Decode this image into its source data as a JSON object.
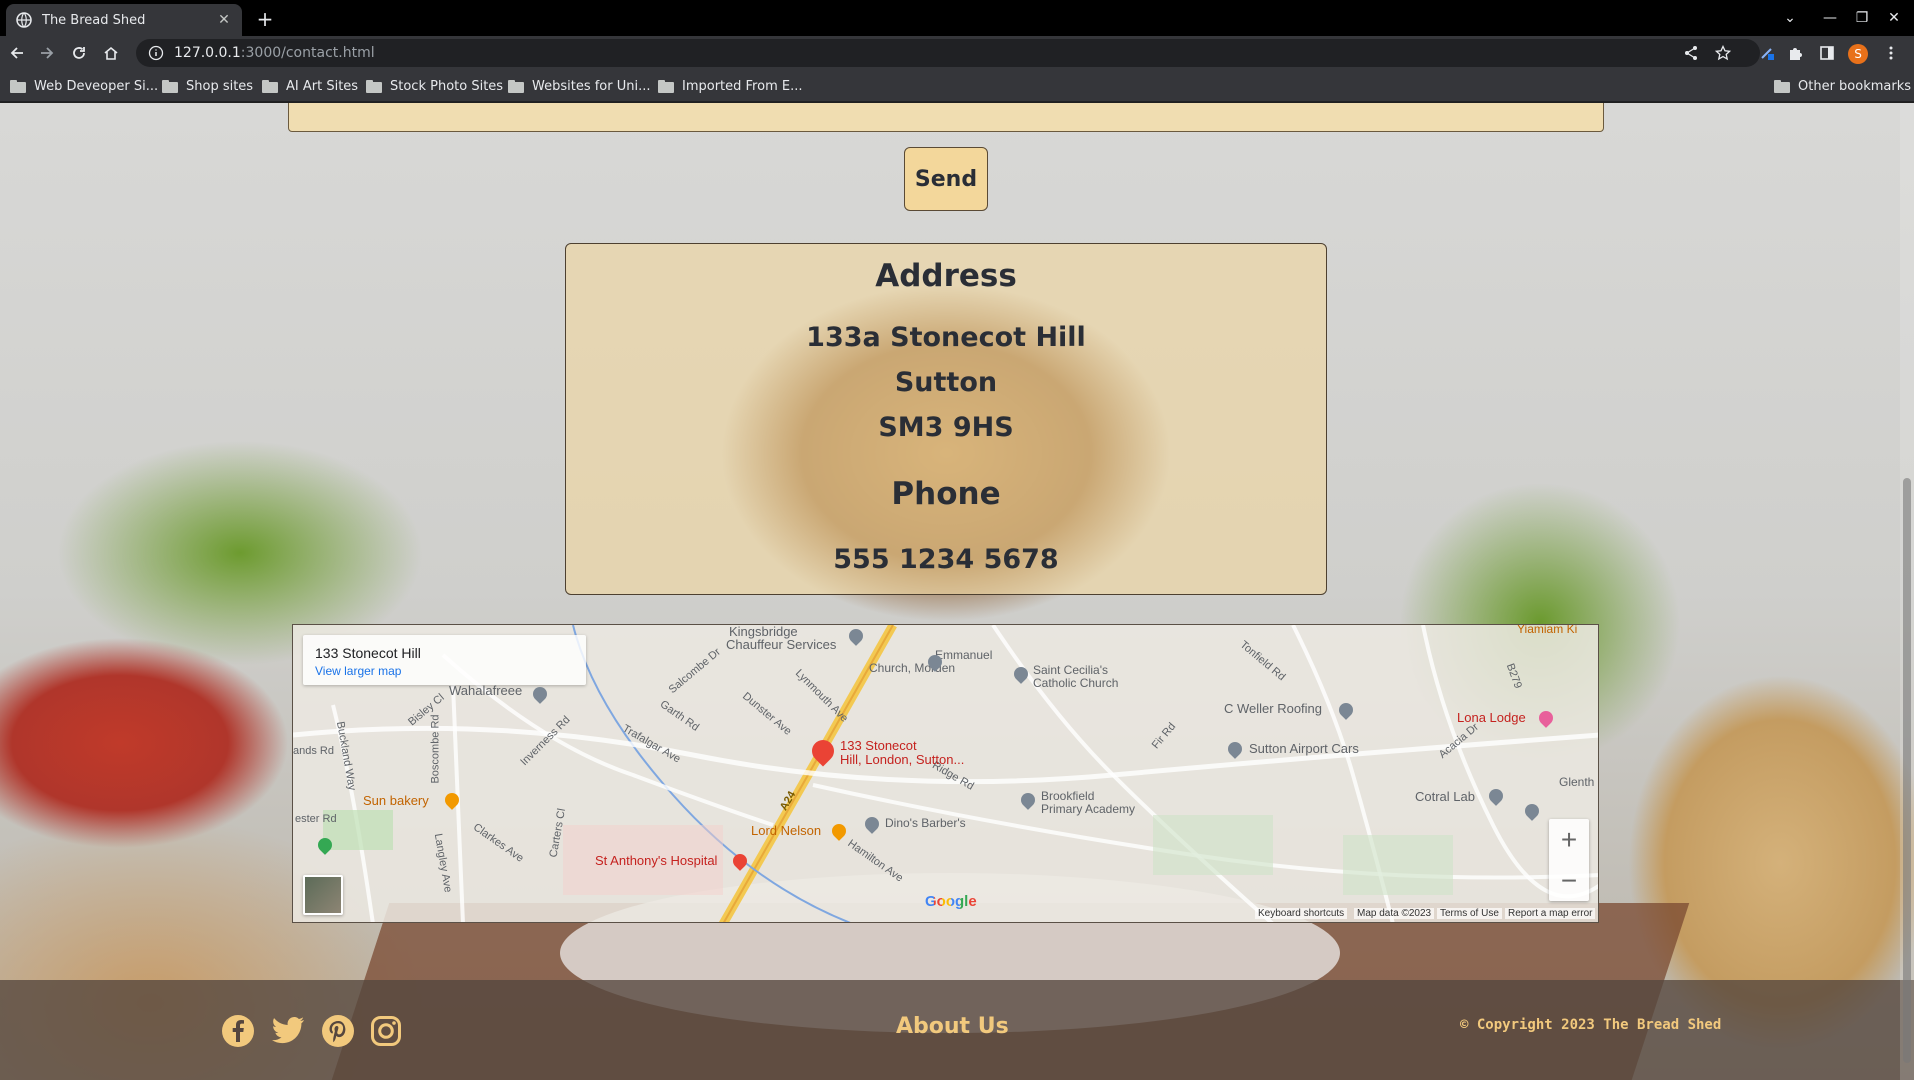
{
  "browser": {
    "tab_title": "The Bread Shed",
    "url_host": "127.0.0.1",
    "url_path": ":3000/contact.html",
    "profile_initial": "S",
    "bookmarks": [
      "Web Deveoper Si...",
      "Shop sites",
      "AI Art Sites",
      "Stock Photo Sites",
      "Websites for Uni...",
      "Imported From E..."
    ],
    "other_bookmarks": "Other bookmarks"
  },
  "page": {
    "send_label": "Send",
    "address_heading": "Address",
    "address_lines": [
      "133a Stonecot Hill",
      "Sutton",
      "SM3 9HS"
    ],
    "phone_heading": "Phone",
    "phone_number": "555 1234 5678"
  },
  "map": {
    "place_title": "133 Stonecot Hill",
    "view_larger": "View larger map",
    "marker_label_1": "133 Stonecot",
    "marker_label_2": "Hill, London, Sutton...",
    "pois": [
      "Kingsbridge",
      "Chauffeur Services",
      "Emmanuel",
      "Church, Morden",
      "Saint Cecilia's",
      "Catholic Church",
      "Wahalafreee",
      "C Weller Roofing",
      "Lona Lodge",
      "Sutton Airport Cars",
      "Sun bakery",
      "Brookfield",
      "Primary Academy",
      "Cotral Lab",
      "Lord Nelson",
      "Dino's Barber's",
      "St Anthony's Hospital",
      "Yiamiam Ki",
      "Glenth"
    ],
    "roads": [
      "Salcombe Dr",
      "Lynmouth Ave",
      "Dunster Ave",
      "Garth Rd",
      "Trafalgar Ave",
      "Inverness Rd",
      "Bisley Cl",
      "Boscombe Rd",
      "Buckland Way",
      "Clarkes Ave",
      "Carters Cl",
      "Langley Ave",
      "Hamilton Ave",
      "Ridge Rd",
      "Fir Rd",
      "Tonfield Rd",
      "Acacia Dr",
      "ands Rd",
      "ester Rd",
      "A24",
      "B279"
    ],
    "google_label": "Google",
    "attribution": [
      "Keyboard shortcuts",
      "Map data ©2023",
      "Terms of Use",
      "Report a map error"
    ]
  },
  "footer": {
    "about_label": "About Us",
    "copyright": "© Copyright 2023 The Bread Shed",
    "social_icons": [
      "facebook-icon",
      "twitter-icon",
      "pinterest-icon",
      "instagram-icon"
    ]
  },
  "colors": {
    "accent_gold": "#f2c97d",
    "text_dark": "#2a2e36",
    "footer_bg": "#55463e",
    "marker_red": "#ea4335"
  }
}
